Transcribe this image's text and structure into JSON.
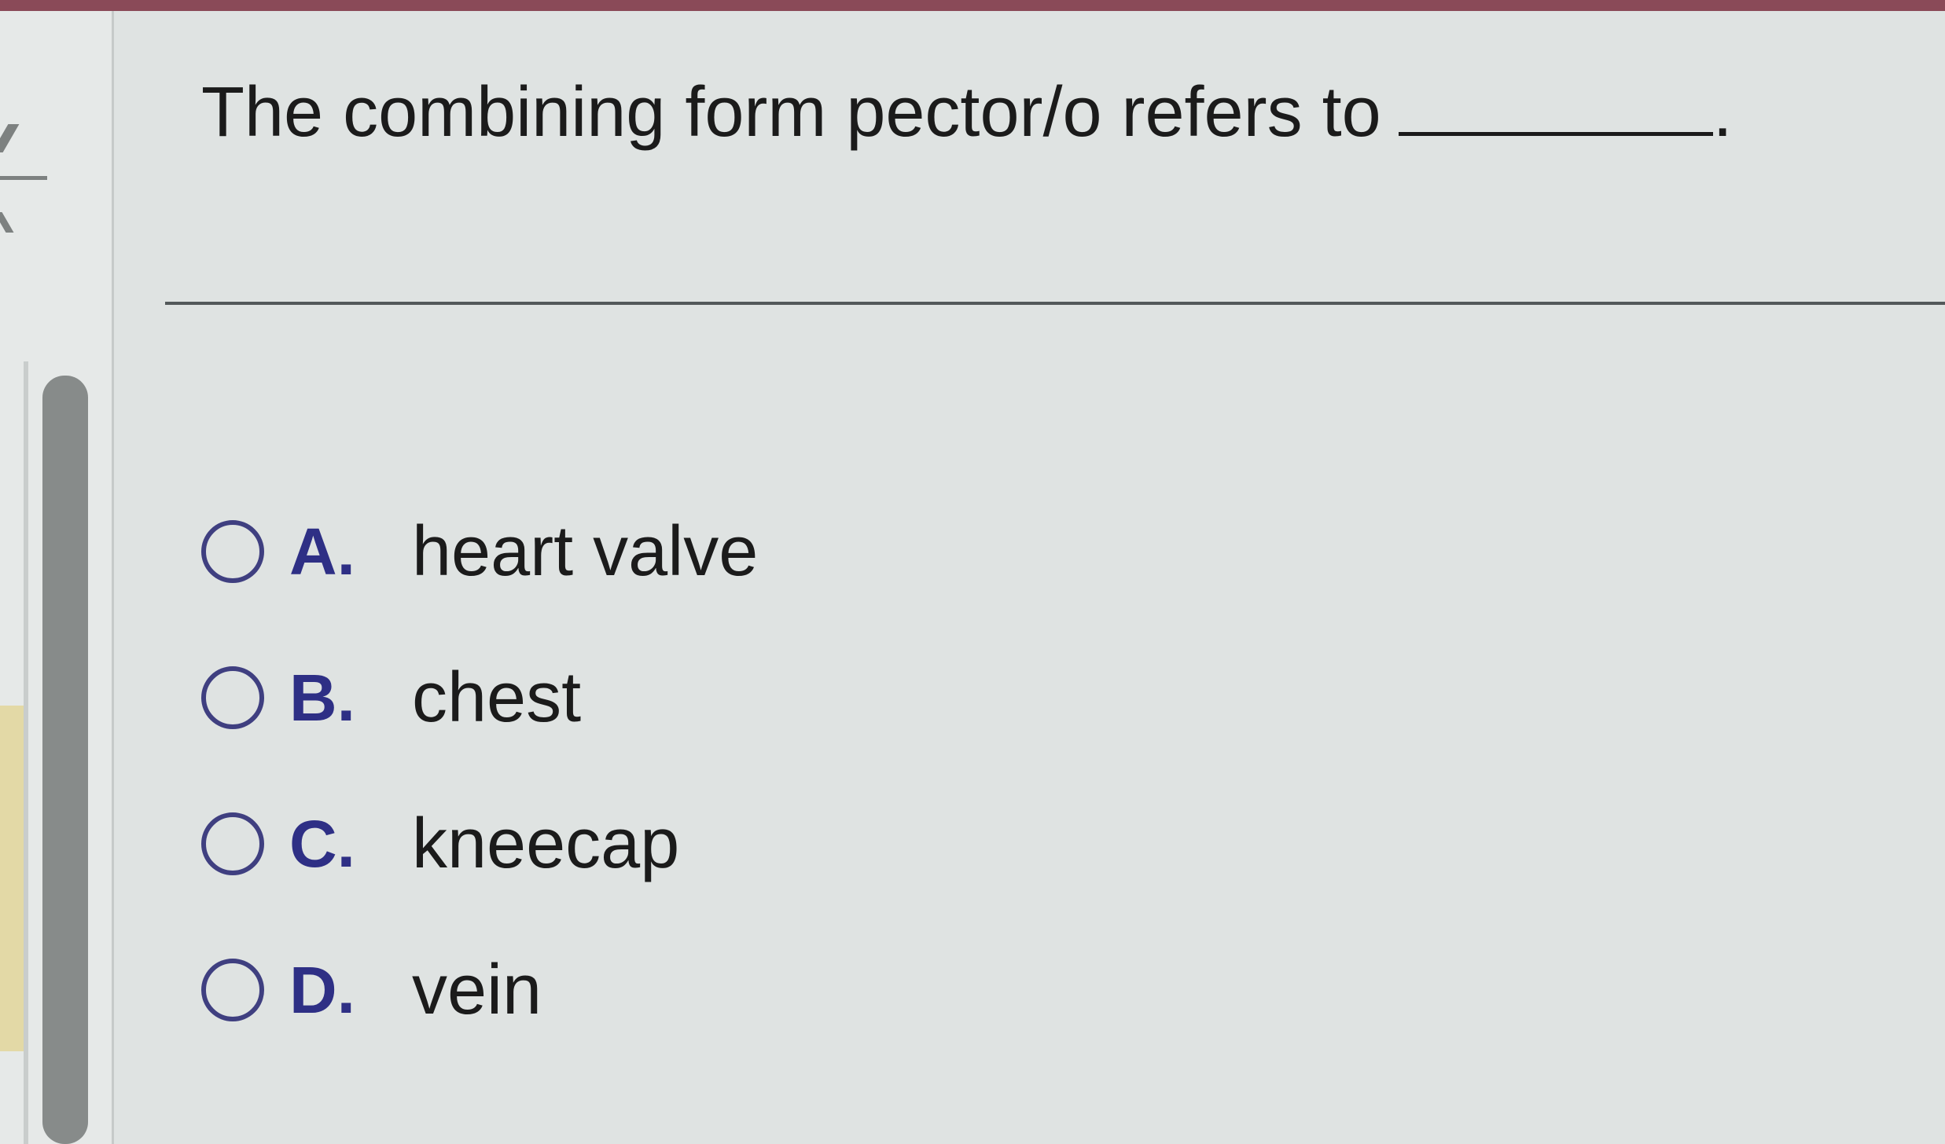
{
  "question": {
    "text": "The combining form pector/o refers to",
    "end_punctuation": "."
  },
  "options": [
    {
      "letter": "A.",
      "text": "heart valve"
    },
    {
      "letter": "B.",
      "text": "chest"
    },
    {
      "letter": "C.",
      "text": "kneecap"
    },
    {
      "letter": "D.",
      "text": "vein"
    }
  ],
  "colors": {
    "accent": "#2e2f85",
    "radio_border": "#3f3f80",
    "background": "#dfe3e2",
    "top_bar": "#8a4a58"
  }
}
